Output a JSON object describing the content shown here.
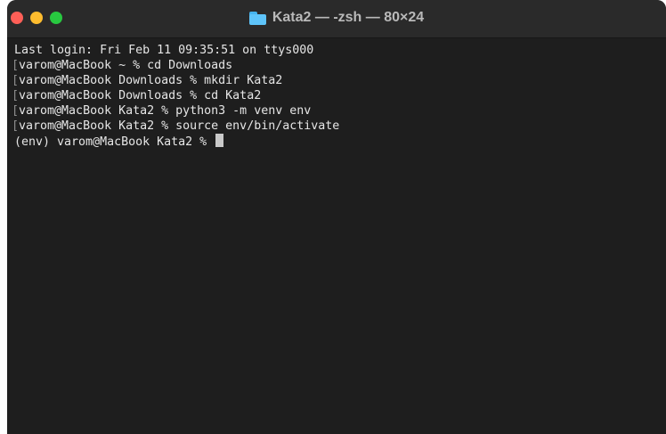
{
  "window": {
    "title": "Kata2 — -zsh — 80×24",
    "title_icon": "folder-icon",
    "controls": {
      "close_color": "#ff5f57",
      "minimize_color": "#febc2e",
      "zoom_color": "#28c840"
    }
  },
  "terminal": {
    "lines": [
      "Last login: Fri Feb 11 09:35:51 on ttys000",
      "varom@MacBook ~ % cd Downloads",
      "varom@MacBook Downloads % mkdir Kata2",
      "varom@MacBook Downloads % cd Kata2",
      "varom@MacBook Kata2 % python3 -m venv env",
      "varom@MacBook Kata2 % source env/bin/activate"
    ],
    "prompt": "(env) varom@MacBook Kata2 % "
  }
}
